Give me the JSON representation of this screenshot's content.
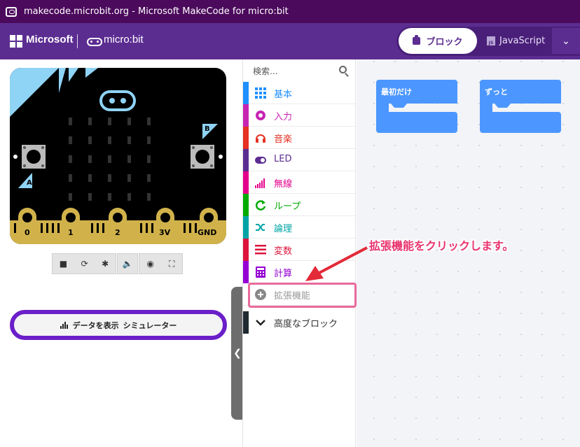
{
  "window": {
    "title": "makecode.microbit.org - Microsoft MakeCode for micro:bit"
  },
  "header": {
    "microsoft_label": "Microsoft",
    "microbit_label": "micro:bit",
    "tabs": [
      {
        "label": "ブロック",
        "active": true
      },
      {
        "label": "JavaScript",
        "active": false
      }
    ]
  },
  "simulator": {
    "buttons": {
      "a": "A",
      "b": "B"
    },
    "pins": [
      "0",
      "1",
      "2",
      "3V",
      "GND"
    ],
    "show_data": {
      "label_prefix": "データを表示",
      "label_suffix": "シミュレーター"
    }
  },
  "toolbox": {
    "search_placeholder": "検索...",
    "categories": [
      {
        "label": "基本",
        "color": "#1e90ff",
        "icon": "grid-icon"
      },
      {
        "label": "入力",
        "color": "#c724b1",
        "icon": "circle-dot-icon"
      },
      {
        "label": "音楽",
        "color": "#e63022",
        "icon": "headphones-icon"
      },
      {
        "label": "LED",
        "color": "#5c2d91",
        "icon": "toggle-icon"
      },
      {
        "label": "無線",
        "color": "#e3008c",
        "icon": "signal-bars-icon"
      },
      {
        "label": "ループ",
        "color": "#00aa00",
        "icon": "loop-icon"
      },
      {
        "label": "論理",
        "color": "#00a4a6",
        "icon": "shuffle-icon"
      },
      {
        "label": "変数",
        "color": "#dc143c",
        "icon": "lines-icon"
      },
      {
        "label": "計算",
        "color": "#9400d3",
        "icon": "calculator-icon"
      },
      {
        "label": "拡張機能",
        "color": "#aaaaaa",
        "icon": "plus-circle-icon"
      },
      {
        "label": "高度なブロック",
        "color": "#222222",
        "icon": "chevron-down-icon"
      }
    ]
  },
  "workspace": {
    "blocks": [
      {
        "label": "最初だけ",
        "color": "#4c97ff"
      },
      {
        "label": "ずっと",
        "color": "#4c97ff"
      }
    ]
  },
  "annotation": {
    "text": "拡張機能をクリックします。"
  }
}
